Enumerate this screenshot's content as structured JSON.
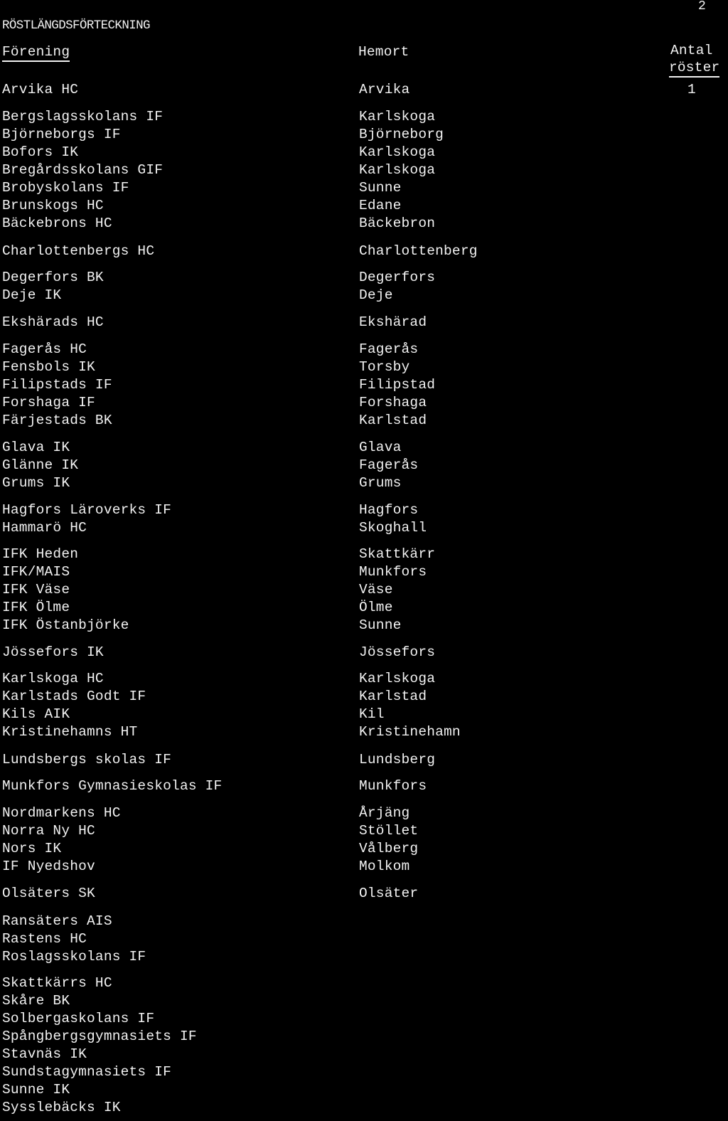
{
  "document": {
    "page_number": "2",
    "title": "RÖSTLÄNGDSFÖRTECKNING",
    "columns": {
      "forening": "Förening",
      "hemort": "Hemort",
      "antal_line1": "Antal",
      "antal_line2": "röster"
    },
    "groups": [
      {
        "rows": [
          {
            "forening": "Arvika HC",
            "hemort": "Arvika",
            "roster": "1"
          }
        ]
      },
      {
        "rows": [
          {
            "forening": "Bergslagsskolans IF",
            "hemort": "Karlskoga"
          },
          {
            "forening": "Björneborgs IF",
            "hemort": "Björneborg"
          },
          {
            "forening": "Bofors IK",
            "hemort": "Karlskoga"
          },
          {
            "forening": "Bregårdsskolans GIF",
            "hemort": "Karlskoga"
          },
          {
            "forening": "Brobyskolans IF",
            "hemort": "Sunne"
          },
          {
            "forening": "Brunskogs HC",
            "hemort": "Edane"
          },
          {
            "forening": "Bäckebrons HC",
            "hemort": "Bäckebron"
          }
        ]
      },
      {
        "rows": [
          {
            "forening": "Charlottenbergs HC",
            "hemort": "Charlottenberg"
          }
        ]
      },
      {
        "rows": [
          {
            "forening": "Degerfors BK",
            "hemort": "Degerfors"
          },
          {
            "forening": "Deje IK",
            "hemort": "Deje"
          }
        ]
      },
      {
        "rows": [
          {
            "forening": "Ekshärads HC",
            "hemort": "Ekshärad"
          }
        ]
      },
      {
        "rows": [
          {
            "forening": "Fagerås HC",
            "hemort": "Fagerås"
          },
          {
            "forening": "Fensbols IK",
            "hemort": "Torsby"
          },
          {
            "forening": "Filipstads IF",
            "hemort": "Filipstad"
          },
          {
            "forening": "Forshaga IF",
            "hemort": "Forshaga"
          },
          {
            "forening": "Färjestads BK",
            "hemort": "Karlstad"
          }
        ]
      },
      {
        "rows": [
          {
            "forening": "Glava IK",
            "hemort": "Glava"
          },
          {
            "forening": "Glänne IK",
            "hemort": "Fagerås"
          },
          {
            "forening": "Grums IK",
            "hemort": "Grums"
          }
        ]
      },
      {
        "rows": [
          {
            "forening": "Hagfors Läroverks IF",
            "hemort": "Hagfors"
          },
          {
            "forening": "Hammarö HC",
            "hemort": "Skoghall"
          }
        ]
      },
      {
        "rows": [
          {
            "forening": "IFK Heden",
            "hemort": "Skattkärr"
          },
          {
            "forening": "IFK/MAIS",
            "hemort": "Munkfors"
          },
          {
            "forening": "IFK Väse",
            "hemort": "Väse"
          },
          {
            "forening": "IFK Ölme",
            "hemort": "Ölme"
          },
          {
            "forening": "IFK Östanbjörke",
            "hemort": "Sunne"
          }
        ]
      },
      {
        "rows": [
          {
            "forening": "Jössefors IK",
            "hemort": "Jössefors"
          }
        ]
      },
      {
        "rows": [
          {
            "forening": "Karlskoga HC",
            "hemort": "Karlskoga"
          },
          {
            "forening": "Karlstads Godt IF",
            "hemort": "Karlstad"
          },
          {
            "forening": "Kils AIK",
            "hemort": "Kil"
          },
          {
            "forening": "Kristinehamns HT",
            "hemort": "Kristinehamn"
          }
        ]
      },
      {
        "rows": [
          {
            "forening": "Lundsbergs skolas IF",
            "hemort": "Lundsberg"
          }
        ]
      },
      {
        "rows": [
          {
            "forening": "Munkfors Gymnasieskolas IF",
            "hemort": "Munkfors"
          }
        ]
      },
      {
        "rows": [
          {
            "forening": "Nordmarkens HC",
            "hemort": "Årjäng"
          },
          {
            "forening": "Norra Ny HC",
            "hemort": "Stöllet"
          },
          {
            "forening": "Nors IK",
            "hemort": "Vålberg"
          },
          {
            "forening": "IF Nyedshov",
            "hemort": "Molkom"
          }
        ]
      },
      {
        "rows": [
          {
            "forening": "Olsäters SK",
            "hemort": "Olsäter"
          }
        ]
      },
      {
        "rows": [
          {
            "forening": "Ransäters AIS"
          },
          {
            "forening": "Rastens HC"
          },
          {
            "forening": "Roslagsskolans IF"
          }
        ]
      },
      {
        "rows": [
          {
            "forening": "Skattkärrs HC"
          },
          {
            "forening": "Skåre BK"
          },
          {
            "forening": "Solbergaskolans IF"
          },
          {
            "forening": "Spångbergsgymnasiets IF"
          },
          {
            "forening": "Stavnäs IK"
          },
          {
            "forening": "Sundstagymnasiets IF"
          },
          {
            "forening": "Sunne IK"
          },
          {
            "forening": "Sysslebäcks IK"
          }
        ]
      }
    ]
  }
}
